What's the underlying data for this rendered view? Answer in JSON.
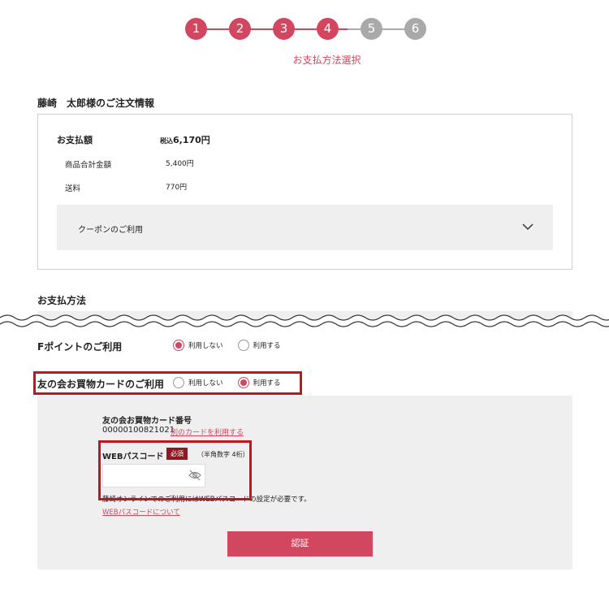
{
  "stepper": {
    "steps": [
      "1",
      "2",
      "3",
      "4",
      "5",
      "6"
    ],
    "current": 4,
    "caption": "お支払方法選択"
  },
  "order": {
    "title": "藤崎　太郎様のご注文情報",
    "total_label": "お支払額",
    "total_tax_note": "税込",
    "total_value": "6,170円",
    "subtotal_label": "商品合計金額",
    "subtotal_value": "5,400円",
    "shipping_label": "送料",
    "shipping_value": "770円",
    "coupon_label": "クーポンのご利用"
  },
  "payment": {
    "title": "お支払方法"
  },
  "fpoint": {
    "label": "Fポイントのご利用",
    "options": [
      "利用しない",
      "利用する"
    ],
    "selected": 0
  },
  "friend_card": {
    "label": "友の会お買物カードのご利用",
    "options": [
      "利用しない",
      "利用する"
    ],
    "selected": 1,
    "number_label": "友の会お買物カード番号",
    "number_value": "00000100821021",
    "other_card_link": "別のカードを利用する",
    "password_label": "WEBパスコード",
    "required_badge": "必須",
    "password_hint": "（半角数字 4桁）",
    "password_value": "",
    "note": "藤崎オンラインでのご利用にはWEBパスコードの設定が必要です。",
    "about_link": "WEBパスコードについて",
    "submit_label": "認証"
  },
  "colors": {
    "accent": "#d1475f",
    "inactive": "#a9a9a9",
    "highlight": "#c0171f",
    "badge": "#8d1a22",
    "panel": "#efefef"
  }
}
